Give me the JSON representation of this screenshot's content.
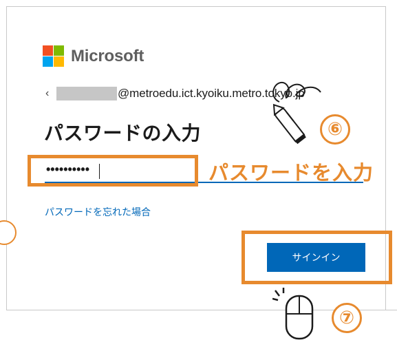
{
  "brand": {
    "name": "Microsoft",
    "colors": [
      "#f25022",
      "#7fba00",
      "#00a4ef",
      "#ffb900"
    ]
  },
  "identity": {
    "back_icon": "‹",
    "email_domain": "@metroedu.ict.kyoiku.metro.tokyo.jp"
  },
  "title": "パスワードの入力",
  "password": {
    "value": "••••••••••"
  },
  "forgot_link": "パスワードを忘れた場合",
  "signin_button": "サインイン",
  "annotations": {
    "password_hint": "パスワードを入力",
    "step6": "⑥",
    "step7": "⑦",
    "accent_color": "#e78a2e"
  },
  "icons": [
    "pen-icon",
    "mouse-icon",
    "back-arrow-icon"
  ]
}
